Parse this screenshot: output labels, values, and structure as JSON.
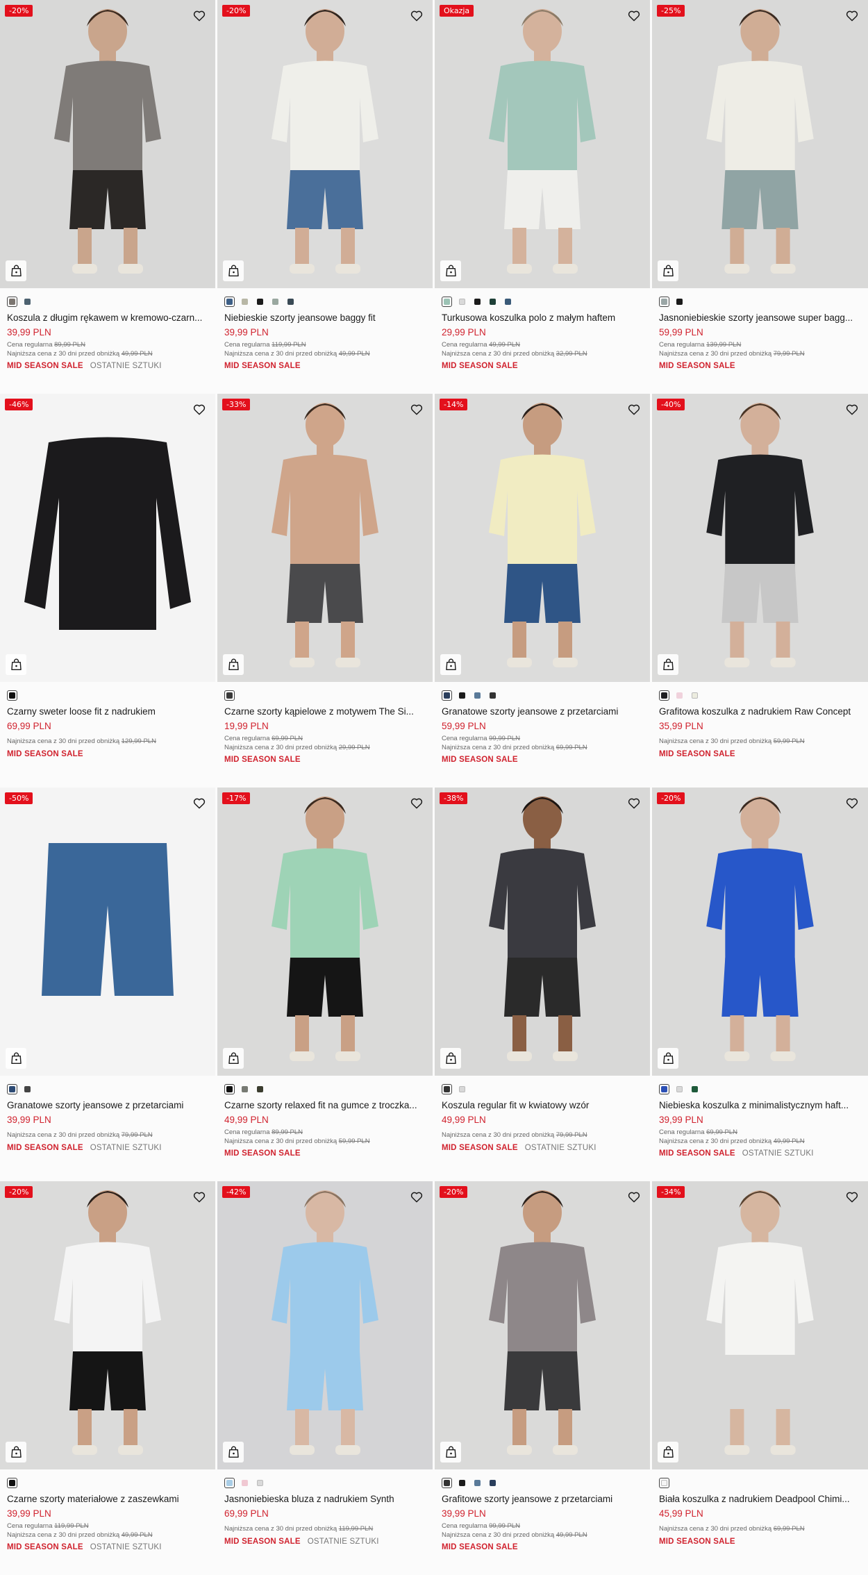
{
  "colors": {
    "price": "#d0222e",
    "badge_red": "#e3101c",
    "text": "#1a1a1a",
    "muted": "#666666",
    "photo_bg": "#d9d9d9"
  },
  "labels": {
    "regular_price": "Cena regularna",
    "lowest_price": "Najniższa cena z 30 dni przed obniżką",
    "sale_tag": "MID SEASON SALE",
    "last_items_tag": "OSTATNIE SZTUKI"
  },
  "icons": {
    "wishlist": "heart-icon",
    "cart": "shopping-bag-icon"
  },
  "products": [
    {
      "badge": "-20%",
      "badge_color": "#e3101c",
      "name": "Koszula z długim rękawem w kremowo-czarn...",
      "price": "39,99 PLN",
      "regular": "Cena regularna",
      "regular_value": "89,99 PLN",
      "lowest_value": "49,99 PLN",
      "tags": [
        "MID SEASON SALE",
        "OSTATNIE SZTUKI"
      ],
      "swatches": [
        "#7b7570",
        "#4d6270"
      ],
      "photo": {
        "bg": "#d8d8d7",
        "top": "#7f7b78",
        "bottom": "#2b2826",
        "skin": "#c9a58c",
        "hair": "#3b2a1f"
      }
    },
    {
      "badge": "-20%",
      "badge_color": "#e3101c",
      "name": "Niebieskie szorty jeansowe baggy fit",
      "price": "39,99 PLN",
      "regular": "Cena regularna",
      "regular_value": "119,99 PLN",
      "lowest_value": "49,99 PLN",
      "tags": [
        "MID SEASON SALE"
      ],
      "swatches": [
        "#3d5f86",
        "#b8b7a6",
        "#1c1c1c",
        "#9aa8a0",
        "#3a4a55"
      ],
      "photo": {
        "bg": "#dcdcdb",
        "top": "#efefea",
        "bottom": "#4a6f9a",
        "skin": "#d1ad96",
        "hair": "#2f241d"
      }
    },
    {
      "badge": "Okazja",
      "badge_color": "#e3101c",
      "name": "Turkusowa koszulka polo z małym haftem",
      "price": "29,99 PLN",
      "regular": "Cena regularna",
      "regular_value": "49,99 PLN",
      "lowest_value": "32,99 PLN",
      "tags": [
        "MID SEASON SALE"
      ],
      "swatches": [
        "#9cc3b5",
        "#d9d9d9",
        "#1b1b1b",
        "#1f4038",
        "#3a5a78"
      ],
      "photo": {
        "bg": "#dadad9",
        "top": "#a3c7bb",
        "bottom": "#efefec",
        "skin": "#d4b29c",
        "hair": "#8b7a66"
      }
    },
    {
      "badge": "-25%",
      "badge_color": "#e3101c",
      "name": "Jasnoniebieskie szorty jeansowe super bagg...",
      "price": "59,99 PLN",
      "regular": "Cena regularna",
      "regular_value": "139,99 PLN",
      "lowest_value": "79,99 PLN",
      "tags": [
        "MID SEASON SALE"
      ],
      "swatches": [
        "#9aa6a6",
        "#1b1b1b"
      ],
      "photo": {
        "bg": "#d9d9d8",
        "top": "#eeede6",
        "bottom": "#90a4a4",
        "skin": "#d0ad95",
        "hair": "#3a2b22"
      }
    },
    {
      "badge": "-46%",
      "badge_color": "#e3101c",
      "name": "Czarny sweter loose fit z nadrukiem",
      "price": "69,99 PLN",
      "regular": "",
      "regular_value": "",
      "lowest_value": "129,99 PLN",
      "tags": [
        "MID SEASON SALE"
      ],
      "swatches": [
        "#111111"
      ],
      "photo": {
        "bg": "#f4f4f4",
        "top": "#1b1a1c",
        "bottom": "",
        "skin": "",
        "hair": ""
      }
    },
    {
      "badge": "-33%",
      "badge_color": "#e3101c",
      "name": "Czarne szorty kąpielowe z motywem The Si...",
      "price": "19,99 PLN",
      "regular": "Cena regularna",
      "regular_value": "69,99 PLN",
      "lowest_value": "29,99 PLN",
      "tags": [
        "MID SEASON SALE"
      ],
      "swatches": [
        "#3a3a3a"
      ],
      "photo": {
        "bg": "#dbdbda",
        "top": "#cfa58a",
        "bottom": "#4a4a4c",
        "skin": "#cfa58a",
        "hair": "#3b2a1f"
      }
    },
    {
      "badge": "-14%",
      "badge_color": "#e3101c",
      "name": "Granatowe szorty jeansowe z przetarciami",
      "price": "59,99 PLN",
      "regular": "Cena regularna",
      "regular_value": "99,99 PLN",
      "lowest_value": "69,99 PLN",
      "tags": [
        "MID SEASON SALE"
      ],
      "swatches": [
        "#2a3e5c",
        "#1b1b1b",
        "#5a7a99",
        "#333333"
      ],
      "photo": {
        "bg": "#dcdcdb",
        "top": "#f1ecc2",
        "bottom": "#2f5586",
        "skin": "#c69c80",
        "hair": "#2b201a"
      }
    },
    {
      "badge": "-40%",
      "badge_color": "#e3101c",
      "name": "Grafitowa koszulka z nadrukiem Raw Concept",
      "price": "35,99 PLN",
      "regular": "",
      "regular_value": "",
      "lowest_value": "59,99 PLN",
      "tags": [
        "MID SEASON SALE"
      ],
      "swatches": [
        "#1f1f22",
        "#f0d2dc",
        "#ececdf"
      ],
      "photo": {
        "bg": "#dbdbda",
        "top": "#1f2023",
        "bottom": "#c7c7c7",
        "skin": "#d3b09a",
        "hair": "#4a3526"
      }
    },
    {
      "badge": "-50%",
      "badge_color": "#e3101c",
      "name": "Granatowe szorty jeansowe z przetarciami",
      "price": "39,99 PLN",
      "regular": "",
      "regular_value": "",
      "lowest_value": "79,99 PLN",
      "tags": [
        "MID SEASON SALE",
        "OSTATNIE SZTUKI"
      ],
      "swatches": [
        "#2c4a74",
        "#444444"
      ],
      "photo": {
        "bg": "#f4f4f4",
        "top": "",
        "bottom": "#3a6799",
        "skin": "",
        "hair": ""
      }
    },
    {
      "badge": "-17%",
      "badge_color": "#e3101c",
      "name": "Czarne szorty relaxed fit na gumce z troczka...",
      "price": "49,99 PLN",
      "regular": "Cena regularna",
      "regular_value": "89,99 PLN",
      "lowest_value": "59,99 PLN",
      "tags": [
        "MID SEASON SALE"
      ],
      "swatches": [
        "#111111",
        "#777a73",
        "#3b3d2f"
      ],
      "photo": {
        "bg": "#dadad9",
        "top": "#9ed3b6",
        "bottom": "#151515",
        "skin": "#c9a085",
        "hair": "#3b2a1f"
      }
    },
    {
      "badge": "-38%",
      "badge_color": "#e3101c",
      "name": "Koszula regular fit w kwiatowy wzór",
      "price": "49,99 PLN",
      "regular": "",
      "regular_value": "",
      "lowest_value": "79,99 PLN",
      "tags": [
        "MID SEASON SALE",
        "OSTATNIE SZTUKI"
      ],
      "swatches": [
        "#333333",
        "#d8d8d8"
      ],
      "photo": {
        "bg": "#d8d8d7",
        "top": "#3a3a40",
        "bottom": "#2a2a2a",
        "skin": "#8a5f44",
        "hair": "#1b1512"
      }
    },
    {
      "badge": "-20%",
      "badge_color": "#e3101c",
      "name": "Niebieska koszulka z minimalistycznym haft...",
      "price": "39,99 PLN",
      "regular": "Cena regularna",
      "regular_value": "69,99 PLN",
      "lowest_value": "49,99 PLN",
      "tags": [
        "MID SEASON SALE",
        "OSTATNIE SZTUKI"
      ],
      "swatches": [
        "#2b4fb5",
        "#d9d9d9",
        "#1e5a3a"
      ],
      "photo": {
        "bg": "#dadad9",
        "top": "#2757c9",
        "bottom": "#2757c9",
        "skin": "#d3b09a",
        "hair": "#3a2b22"
      }
    },
    {
      "badge": "-20%",
      "badge_color": "#e3101c",
      "name": "Czarne szorty materiałowe z zaszewkami",
      "price": "39,99 PLN",
      "regular": "Cena regularna",
      "regular_value": "119,99 PLN",
      "lowest_value": "49,99 PLN",
      "tags": [
        "MID SEASON SALE",
        "OSTATNIE SZTUKI"
      ],
      "swatches": [
        "#111111"
      ],
      "photo": {
        "bg": "#dbdbda",
        "top": "#f4f4f4",
        "bottom": "#151515",
        "skin": "#c9a085",
        "hair": "#2b201a"
      }
    },
    {
      "badge": "-42%",
      "badge_color": "#e3101c",
      "name": "Jasnoniebieska bluza z nadrukiem Synth",
      "price": "69,99 PLN",
      "regular": "",
      "regular_value": "",
      "lowest_value": "119,99 PLN",
      "tags": [
        "MID SEASON SALE",
        "OSTATNIE SZTUKI"
      ],
      "swatches": [
        "#a9cde6",
        "#f0c8d2",
        "#d9d9d9"
      ],
      "photo": {
        "bg": "#d4d4d6",
        "top": "#9ccaeb",
        "bottom": "#9ccaeb",
        "skin": "#d8b8a4",
        "hair": "#8a7360"
      }
    },
    {
      "badge": "-20%",
      "badge_color": "#e3101c",
      "name": "Grafitowe szorty jeansowe z przetarciami",
      "price": "39,99 PLN",
      "regular": "Cena regularna",
      "regular_value": "99,99 PLN",
      "lowest_value": "49,99 PLN",
      "tags": [
        "MID SEASON SALE"
      ],
      "swatches": [
        "#333333",
        "#1b1b1b",
        "#5a7a99",
        "#2a3e5c"
      ],
      "photo": {
        "bg": "#dadad9",
        "top": "#8e8789",
        "bottom": "#3a3a3c",
        "skin": "#c69c80",
        "hair": "#2b201a"
      }
    },
    {
      "badge": "-34%",
      "badge_color": "#e3101c",
      "name": "Biała koszulka z nadrukiem Deadpool Chimi...",
      "price": "45,99 PLN",
      "regular": "",
      "regular_value": "",
      "lowest_value": "69,99 PLN",
      "tags": [
        "MID SEASON SALE"
      ],
      "swatches": [
        "#f5f5f5"
      ],
      "photo": {
        "bg": "#d8d8d7",
        "top": "#f4f4f2",
        "bottom": "",
        "skin": "#d6b6a0",
        "hair": "#5a4330"
      }
    }
  ]
}
